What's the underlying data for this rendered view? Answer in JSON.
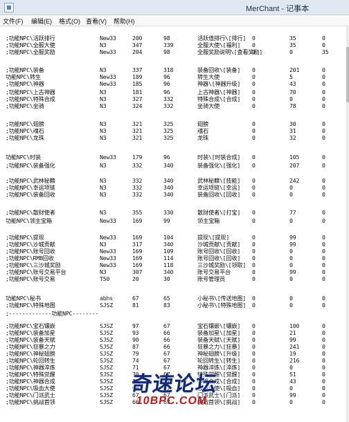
{
  "window": {
    "title": "MerChant - 记事本"
  },
  "menu": [
    "文件(F)",
    "编辑(E)",
    "格式(O)",
    "查看(V)",
    "帮助(H)"
  ],
  "rows": [
    {
      "npc": ";功能NPC\\活跃排行",
      "map": "New33",
      "x": "200",
      "y": "98",
      "name": "活跃值排行\\[排行]",
      "a": "0",
      "b": "35",
      "c": "0"
    },
    {
      "npc": ";功能NPC\\全服大使",
      "map": "N3",
      "x": "347",
      "y": "339",
      "name": "全服大使\\[福利]",
      "a": "0",
      "b": "35",
      "c": "0"
    },
    {
      "npc": ";功能NPC\\全服奖励",
      "map": "New33",
      "x": "204",
      "y": "98",
      "name": "全服奖励说明\\[查看奖励]",
      "a": "0",
      "b": "0",
      "c": "35"
    },
    {
      "npc": ";功能NPC\\装备",
      "map": "N3",
      "x": "337",
      "y": "318",
      "name": "装备回收\\[装备]",
      "a": "0",
      "b": "201",
      "c": "0"
    },
    {
      "npc": "功能NPC\\转生",
      "map": "New33",
      "x": "189",
      "y": "96",
      "name": "转生大使",
      "a": "0",
      "b": "5",
      "c": "0"
    },
    {
      "npc": ";功能NPC\\神器",
      "map": "New33",
      "x": "185",
      "y": "96",
      "name": "神器\\[神器升级]",
      "a": "0",
      "b": "43",
      "c": "0"
    },
    {
      "npc": ";功能NPC\\上古神器",
      "map": "N3",
      "x": "181",
      "y": "96",
      "name": "上古神器\\[神器]",
      "a": "0",
      "b": "70",
      "c": "0"
    },
    {
      "npc": ";功能NPC\\特殊合成",
      "map": "N3",
      "x": "327",
      "y": "332",
      "name": "特殊合成\\[合成]",
      "a": "0",
      "b": "0",
      "c": "0"
    },
    {
      "npc": ";功能NPC\\坐骑",
      "map": "N3",
      "x": "324",
      "y": "332",
      "name": "坐骑大使",
      "a": "0",
      "b": "78",
      "c": "0"
    },
    {
      "npc": ";功能NPC\\翅膀",
      "map": "N3",
      "x": "321",
      "y": "325",
      "name": "翅膀",
      "a": "0",
      "b": "30",
      "c": "0"
    },
    {
      "npc": ";功能NPC\\魂石",
      "map": "N3",
      "x": "321",
      "y": "325",
      "name": "魂石",
      "a": "0",
      "b": "31",
      "c": "0"
    },
    {
      "npc": ";功能NPC\\龙珠",
      "map": "N3",
      "x": "321",
      "y": "325",
      "name": "龙珠",
      "a": "0",
      "b": "32",
      "c": "0"
    },
    {
      "npc": "功能NPC\\时装",
      "map": "New33",
      "x": "179",
      "y": "96",
      "name": "时装\\[时装合成]",
      "a": "0",
      "b": "105",
      "c": "0"
    },
    {
      "npc": ";功能NPC\\装备强化",
      "map": "N3",
      "x": "332",
      "y": "340",
      "name": "装备强化\\[强化]",
      "a": "0",
      "b": "207",
      "c": "0"
    },
    {
      "npc": ";功能NPC\\武林秘籍",
      "map": "N3",
      "x": "332",
      "y": "340",
      "name": "武林秘籍\\[技能]",
      "a": "0",
      "b": "242",
      "c": "0"
    },
    {
      "npc": ";功能NPC\\幸运项链",
      "map": "N3",
      "x": "332",
      "y": "340",
      "name": "幸运项链\\[幸运]",
      "a": "0",
      "b": "0",
      "c": "0"
    },
    {
      "npc": ";功能NPC\\装备回收",
      "map": "N3",
      "x": "332",
      "y": "340",
      "name": "装备回收\\[回收]",
      "a": "0",
      "b": "0",
      "c": "0"
    },
    {
      "npc": ";功能NPC\\散财使者",
      "map": "N3",
      "x": "355",
      "y": "330",
      "name": "散财使者\\[打宝]",
      "a": "0",
      "b": "77",
      "c": "0"
    },
    {
      "npc": "功能NPC\\领主宝箱",
      "map": "New33",
      "x": "169",
      "y": "99",
      "name": "领主宝箱",
      "a": "0",
      "b": "0",
      "c": "0"
    },
    {
      "npc": ";功能NPC\\提现",
      "map": "New33",
      "x": "169",
      "y": "104",
      "name": "提现\\[提现]",
      "a": "0",
      "b": "99",
      "c": "0"
    },
    {
      "npc": ";功能NPC\\沙城贡献",
      "map": "N3",
      "x": "317",
      "y": "340",
      "name": "沙城贡献\\[贡献]",
      "a": "0",
      "b": "99",
      "c": "0"
    },
    {
      "npc": ";功能NPC\\账号回收",
      "map": "New33",
      "x": "169",
      "y": "109",
      "name": "账号回收\\[回收]",
      "a": "0",
      "b": "0",
      "c": "0"
    },
    {
      "npc": ";功能NPC\\RMB回收",
      "map": "New33",
      "x": "169",
      "y": "114",
      "name": "账号回收\\[回收]",
      "a": "0",
      "b": "0",
      "c": "0"
    },
    {
      "npc": ";功能NPC\\三沙城奖励",
      "map": "New33",
      "x": "169",
      "y": "118",
      "name": "三沙城奖励\\[领取]",
      "a": "0",
      "b": "0",
      "c": "0"
    },
    {
      "npc": ";功能NPC\\账号交易平台",
      "map": "N3",
      "x": "307",
      "y": "340",
      "name": "账号交易平台",
      "a": "0",
      "b": "99",
      "c": "0"
    },
    {
      "npc": ";功能NPC\\账号交易",
      "map": "T50",
      "x": "20",
      "y": "30",
      "name": "账号管理员",
      "a": "0",
      "b": "0",
      "c": "0"
    },
    {
      "npc": "功能NPC\\秘书",
      "map": "abhs",
      "x": "67",
      "y": "65",
      "name": "小秘书\\[传送地图]",
      "a": "0",
      "b": "0",
      "c": "0"
    },
    {
      "npc": ";功能NPC\\特殊地图",
      "map": "SJSZ",
      "x": "81",
      "y": "83",
      "name": "小秘书\\[特殊地图]",
      "a": "0",
      "b": "0",
      "c": "0"
    },
    {
      "npc": ";-------------功能NPC--------",
      "map": "",
      "x": "",
      "y": "",
      "name": "",
      "a": "",
      "b": "",
      "c": ""
    },
    {
      "npc": ";功能NPC\\宝石镶嵌",
      "map": "SJSZ",
      "x": "97",
      "y": "67",
      "name": "宝石镶嵌\\[镶嵌]",
      "a": "0",
      "b": "100",
      "c": "0"
    },
    {
      "npc": ";功能NPC\\装备加星",
      "map": "SJSZ",
      "x": "93",
      "y": "66",
      "name": "装备加星\\[加星]",
      "a": "0",
      "b": "21",
      "c": "0"
    },
    {
      "npc": ";功能NPC\\装备天赋",
      "map": "SJSZ",
      "x": "90",
      "y": "66",
      "name": "装备天赋\\[天赋]",
      "a": "0",
      "b": "99",
      "c": "0"
    },
    {
      "npc": ";功能NPC\\狂暴之力",
      "map": "SJSZ",
      "x": "87",
      "y": "66",
      "name": "狂暴之力\\[狂暴]",
      "a": "0",
      "b": "241",
      "c": "0"
    },
    {
      "npc": ";功能NPC\\神秘翅膀",
      "map": "SJSZ",
      "x": "79",
      "y": "67",
      "name": "神秘翅膀\\[升级]",
      "a": "0",
      "b": "19",
      "c": "0"
    },
    {
      "npc": ";功能NPC\\轮回转生",
      "map": "SJSZ",
      "x": "74",
      "y": "67",
      "name": "轮回转生\\[转生]",
      "a": "0",
      "b": "216",
      "c": "0"
    },
    {
      "npc": ";功能NPC\\神器淬炼",
      "map": "SJSZ",
      "x": "71",
      "y": "67",
      "name": "神器淬炼\\[淬炼]",
      "a": "0",
      "b": "0",
      "c": "0"
    },
    {
      "npc": ";功能NPC\\特殊觉醒",
      "map": "SJSZ",
      "x": "70",
      "y": "67",
      "name": "特殊觉醒\\[觉醒]",
      "a": "0",
      "b": "51",
      "c": "0"
    },
    {
      "npc": ";功能NPC\\神器合成",
      "map": "SJSZ",
      "x": "69",
      "y": "67",
      "name": "神器合成\\[合成]",
      "a": "0",
      "b": "43",
      "c": "0"
    },
    {
      "npc": ";功能NPC\\吸血大使",
      "map": "SJSZ",
      "x": "68",
      "y": "67",
      "name": "吸血大使\\[吸血]",
      "a": "0",
      "b": "0",
      "c": "0"
    },
    {
      "npc": ";功能NPC\\门派武士",
      "map": "SJSZ",
      "x": "67",
      "y": "67",
      "name": "门派武士\\[门派]",
      "a": "0",
      "b": "99",
      "c": "0"
    },
    {
      "npc": ";功能NPC\\挑战首领",
      "map": "SJSZ",
      "x": "66",
      "y": "67",
      "name": "挑战首领\\[挑战]",
      "a": "0",
      "b": "0",
      "c": "0"
    }
  ],
  "watermark": {
    "main": "奇速论坛",
    "sub": "10BPC.COM"
  }
}
